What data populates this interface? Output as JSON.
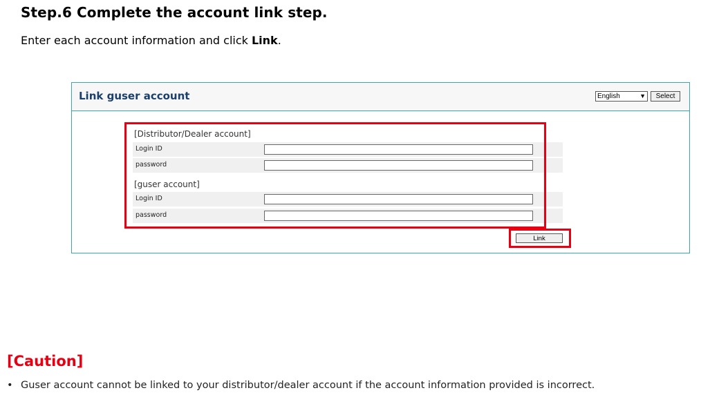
{
  "step": {
    "title": "Step.6  Complete the account link step.",
    "desc_prefix": "Enter each account information and click ",
    "desc_bold": "Link",
    "desc_suffix": "."
  },
  "panel": {
    "title": "Link guser account",
    "language_value": "English",
    "select_label": "Select"
  },
  "distributor": {
    "heading": "[Distributor/Dealer account]",
    "login_label": "Login ID",
    "login_value": "",
    "password_label": "password",
    "password_value": ""
  },
  "guser": {
    "heading": "[guser account]",
    "login_label": "Login ID",
    "login_value": "",
    "password_label": "password",
    "password_value": ""
  },
  "link_label": "Link",
  "caution": {
    "title": "[Caution]",
    "bullet": "•",
    "text": "Guser account cannot be linked to your distributor/dealer account if the account information provided is incorrect."
  },
  "colors": {
    "highlight": "#e60012",
    "panel_border": "#3aa6b0",
    "panel_title": "#1a3f6b"
  }
}
